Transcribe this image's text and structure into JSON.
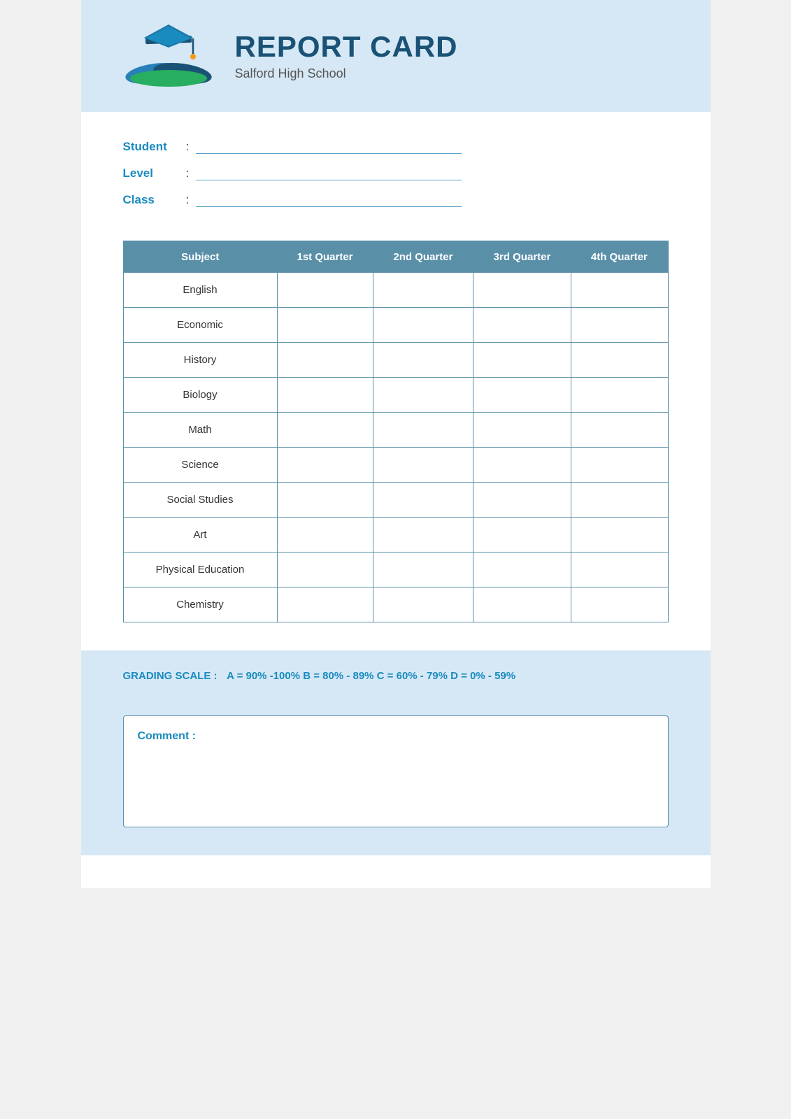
{
  "header": {
    "title": "REPORT CARD",
    "school": "Salford High School"
  },
  "info": {
    "student_label": "Student",
    "level_label": "Level",
    "class_label": "Class"
  },
  "table": {
    "headers": [
      "Subject",
      "1st Quarter",
      "2nd Quarter",
      "3rd Quarter",
      "4th Quarter"
    ],
    "subjects": [
      "English",
      "Economic",
      "History",
      "Biology",
      "Math",
      "Science",
      "Social Studies",
      "Art",
      "Physical Education",
      "Chemistry"
    ]
  },
  "grading_scale": {
    "label": "GRADING SCALE :",
    "text": "A = 90% -100%  B = 80% - 89%  C = 60% - 79%  D = 0% - 59%"
  },
  "comment": {
    "label": "Comment :"
  }
}
